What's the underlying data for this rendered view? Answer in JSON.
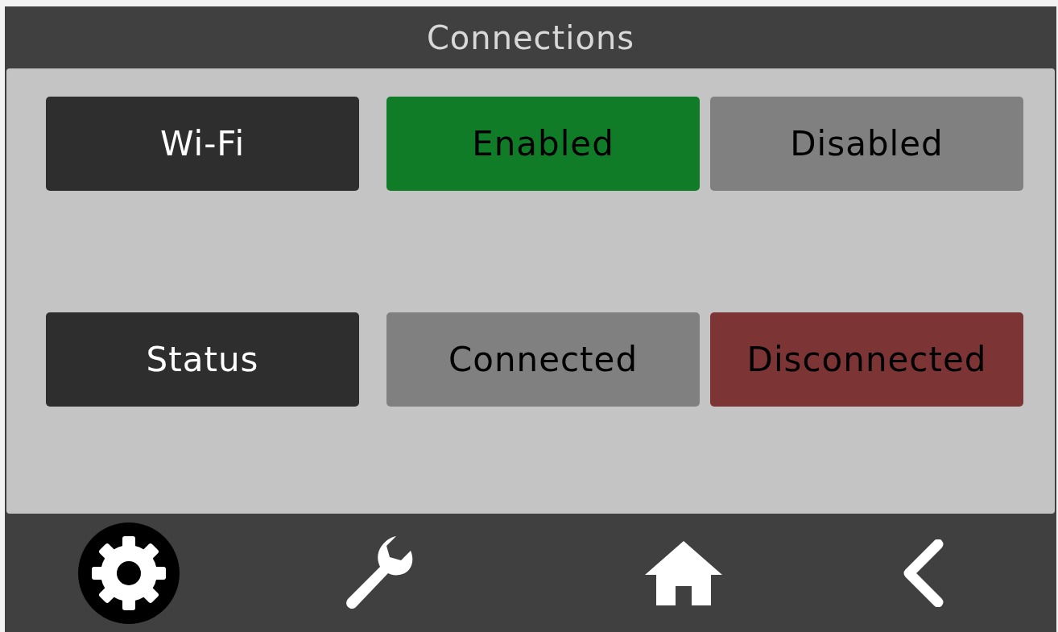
{
  "title": "Connections",
  "rows": [
    {
      "label": "Wi-Fi",
      "options": [
        {
          "label": "Enabled",
          "selected": true,
          "color": "#107c28"
        },
        {
          "label": "Disabled",
          "selected": false
        }
      ]
    },
    {
      "label": "Status",
      "options": [
        {
          "label": "Connected",
          "selected": false
        },
        {
          "label": "Disconnected",
          "selected": true,
          "color": "#7d3434"
        }
      ]
    }
  ],
  "nav": [
    {
      "kind": "settings",
      "selected": true
    },
    {
      "kind": "tools",
      "selected": false
    },
    {
      "kind": "home",
      "selected": false
    },
    {
      "kind": "back",
      "selected": false
    }
  ]
}
